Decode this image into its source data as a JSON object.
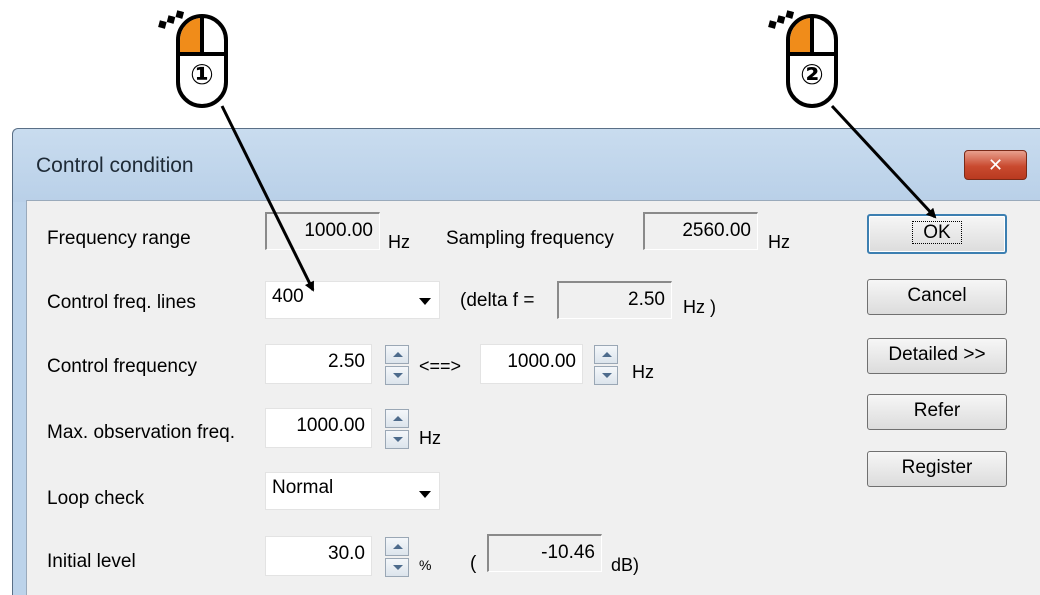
{
  "window": {
    "title": "Control condition",
    "close_glyph": "✕"
  },
  "fields": {
    "frequency_range": {
      "label": "Frequency range",
      "value": "1000.00",
      "unit": "Hz"
    },
    "sampling_frequency": {
      "label": "Sampling frequency",
      "value": "2560.00",
      "unit": "Hz"
    },
    "control_freq_lines": {
      "label": "Control freq. lines",
      "selected": "400"
    },
    "delta_f": {
      "prefix": "(delta f =",
      "value": "2.50",
      "unit": "Hz )"
    },
    "control_frequency": {
      "label": "Control frequency",
      "from": "2.50",
      "arrow": "<==>",
      "to": "1000.00",
      "unit": "Hz"
    },
    "max_observation_freq": {
      "label": "Max. observation freq.",
      "value": "1000.00",
      "unit": "Hz"
    },
    "loop_check": {
      "label": "Loop check",
      "selected": "Normal"
    },
    "initial_level": {
      "label": "Initial level",
      "value": "30.0",
      "unit": "%",
      "paren_open": "(",
      "db_value": "-10.46",
      "db_unit": "dB)"
    }
  },
  "buttons": {
    "ok": "OK",
    "cancel": "Cancel",
    "detailed": "Detailed >>",
    "refer": "Refer",
    "register": "Register"
  },
  "annotations": {
    "mouse1": {
      "number": "①",
      "sparkle": "◆◆◆"
    },
    "mouse2": {
      "number": "②",
      "sparkle": "◆◆◆"
    }
  },
  "colors": {
    "accent_mouse": "#f08c1a",
    "close_button": "#c94a2f",
    "default_button_border": "#3c7fb1"
  }
}
